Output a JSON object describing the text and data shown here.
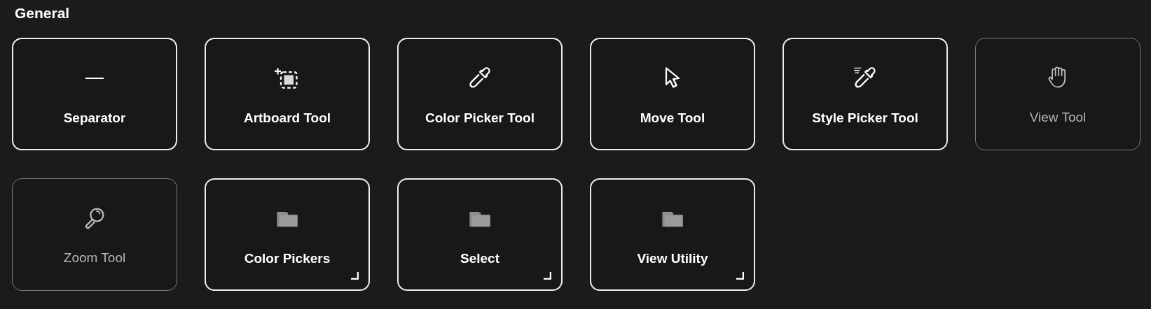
{
  "section": {
    "title": "General"
  },
  "tiles": [
    {
      "label": "Separator",
      "kind": "separator",
      "disabled": false
    },
    {
      "label": "Artboard Tool",
      "kind": "artboard",
      "disabled": false
    },
    {
      "label": "Color Picker Tool",
      "kind": "picker",
      "disabled": false
    },
    {
      "label": "Move Tool",
      "kind": "move",
      "disabled": false
    },
    {
      "label": "Style Picker Tool",
      "kind": "style-picker",
      "disabled": false
    },
    {
      "label": "View Tool",
      "kind": "hand",
      "disabled": true
    },
    {
      "label": "Zoom Tool",
      "kind": "zoom",
      "disabled": true
    },
    {
      "label": "Color Pickers",
      "kind": "folder",
      "disabled": false
    },
    {
      "label": "Select",
      "kind": "folder",
      "disabled": false
    },
    {
      "label": "View Utility",
      "kind": "folder",
      "disabled": false
    }
  ]
}
